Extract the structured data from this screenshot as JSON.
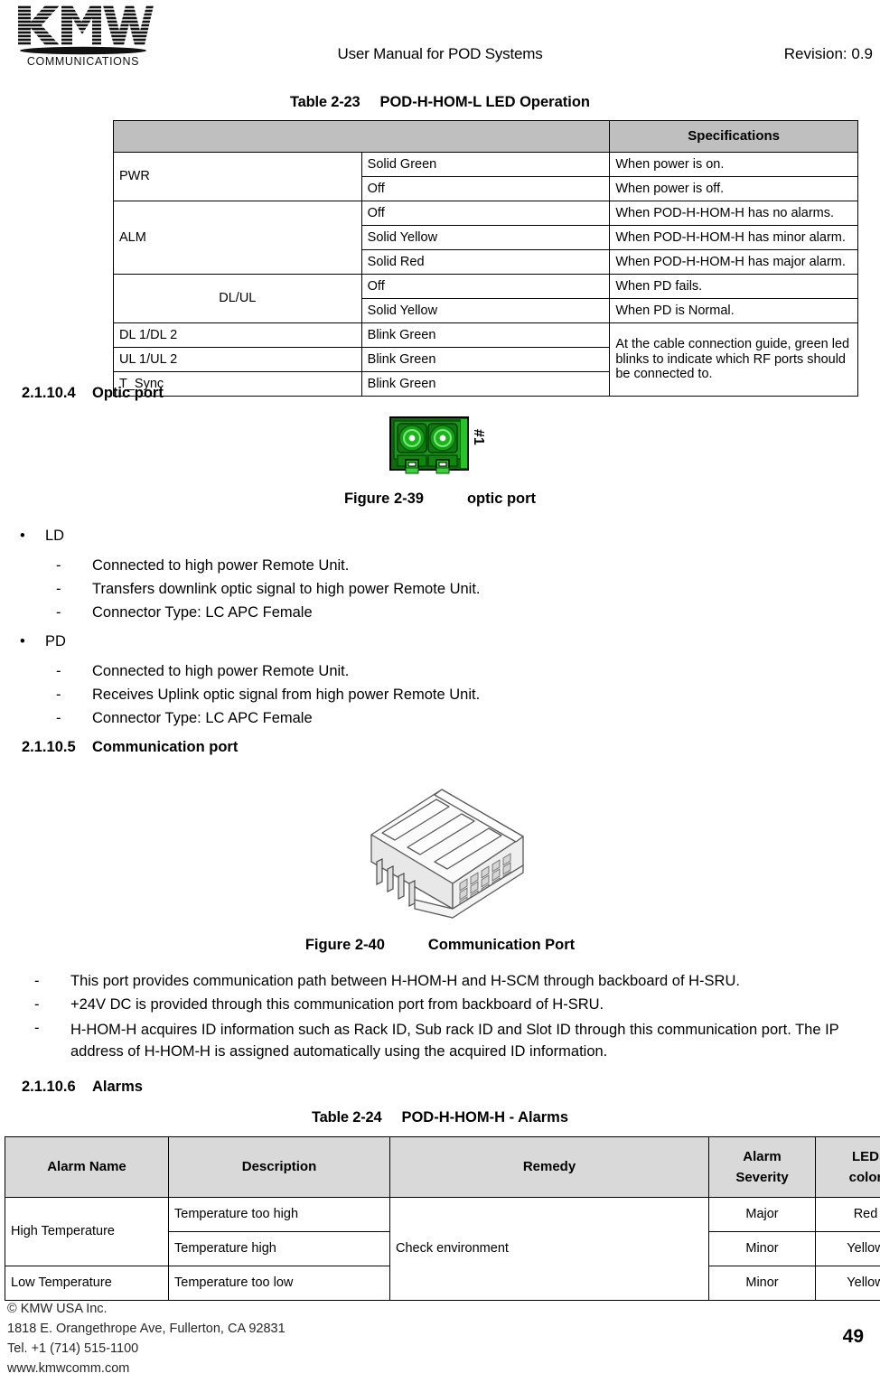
{
  "header": {
    "logo_text": "KMW",
    "logo_subtext": "COMMUNICATIONS",
    "title": "User Manual for POD Systems",
    "revision": "Revision: 0.9"
  },
  "table_2_23": {
    "caption_number": "Table 2-23",
    "caption_title": "POD-H-HOM-L LED Operation",
    "header_blank": "",
    "header_spec": "Specifications",
    "rows": [
      {
        "name": "PWR",
        "state": "Solid Green",
        "spec": "When power is on."
      },
      {
        "name": "",
        "state": "Off",
        "spec": "When power is off."
      },
      {
        "name": "ALM",
        "state": "Off",
        "spec": "When POD-H-HOM-H has no alarms."
      },
      {
        "name": "",
        "state": "Solid Yellow",
        "spec": "When POD-H-HOM-H has minor alarm."
      },
      {
        "name": "",
        "state": "Solid Red",
        "spec": "When POD-H-HOM-H has major alarm."
      },
      {
        "name": "DL/UL",
        "state": "Off",
        "spec": "When PD fails."
      },
      {
        "name": "",
        "state": "Solid Yellow",
        "spec": "When PD is Normal."
      },
      {
        "name": "DL 1/DL 2",
        "state": "Blink Green",
        "spec": ""
      },
      {
        "name": "UL 1/UL 2",
        "state": "Blink Green",
        "spec": ""
      },
      {
        "name": "T_Sync",
        "state": "Blink Green",
        "spec": ""
      }
    ],
    "merged_spec": "At the cable connection guide, green led blinks to indicate which RF ports should be connected to."
  },
  "section_optic": {
    "number": "2.1.10.4",
    "title": "Optic port",
    "figure_number": "Figure 2-39",
    "figure_title": "optic port",
    "port_label": "#1",
    "groups": [
      {
        "label": "LD",
        "items": [
          "Connected to high power Remote Unit.",
          "Transfers downlink optic signal to high power Remote Unit.",
          "Connector Type: LC APC Female"
        ]
      },
      {
        "label": "PD",
        "items": [
          "Connected to high power Remote Unit.",
          "Receives Uplink optic signal from high power Remote Unit.",
          "Connector Type: LC APC Female"
        ]
      }
    ]
  },
  "section_comm": {
    "number": "2.1.10.5",
    "title": "Communication port",
    "figure_number": "Figure 2-40",
    "figure_title": "Communication Port",
    "items": [
      "This port provides communication path between H-HOM-H and H-SCM through backboard of H-SRU.",
      "+24V DC is provided through this communication port from backboard of H-SRU.",
      "H-HOM-H acquires ID information such as Rack ID, Sub rack ID and Slot ID through this communication port. The IP address of H-HOM-H is assigned automatically using the acquired ID information."
    ]
  },
  "section_alarms": {
    "number": "2.1.10.6",
    "title": "Alarms"
  },
  "table_2_24": {
    "caption_number": "Table 2-24",
    "caption_title": "POD-H-HOM-H - Alarms",
    "columns": [
      "Alarm Name",
      "Description",
      "Remedy",
      "Alarm Severity",
      "LED color"
    ],
    "column_lines": {
      "severity_line1": "Alarm",
      "severity_line2": "Severity",
      "led_line1": "LED",
      "led_line2": "color"
    },
    "rows": [
      {
        "name": "High Temperature",
        "description": "Temperature too high",
        "severity": "Major",
        "led": "Red"
      },
      {
        "name": "",
        "description": "Temperature high",
        "severity": "Minor",
        "led": "Yellow"
      },
      {
        "name": "Low Temperature",
        "description": "Temperature too low",
        "severity": "Minor",
        "led": "Yellow"
      }
    ],
    "remedy": "Check environment"
  },
  "footer": {
    "line1": "© KMW USA Inc.",
    "line2": "1818 E. Orangethrope Ave, Fullerton, CA 92831",
    "line3": "Tel. +1 (714) 515-1100",
    "line4": "www.kmwcomm.com",
    "page_number": "49"
  },
  "colors": {
    "table_23_header_fill": "#BFBFBF",
    "table_24_header_fill": "#D9D9D9",
    "optic_port_green": "#1E9E1E",
    "optic_port_dark_green": "#0B5D0B",
    "connector_gray": "#BDBDBD"
  }
}
